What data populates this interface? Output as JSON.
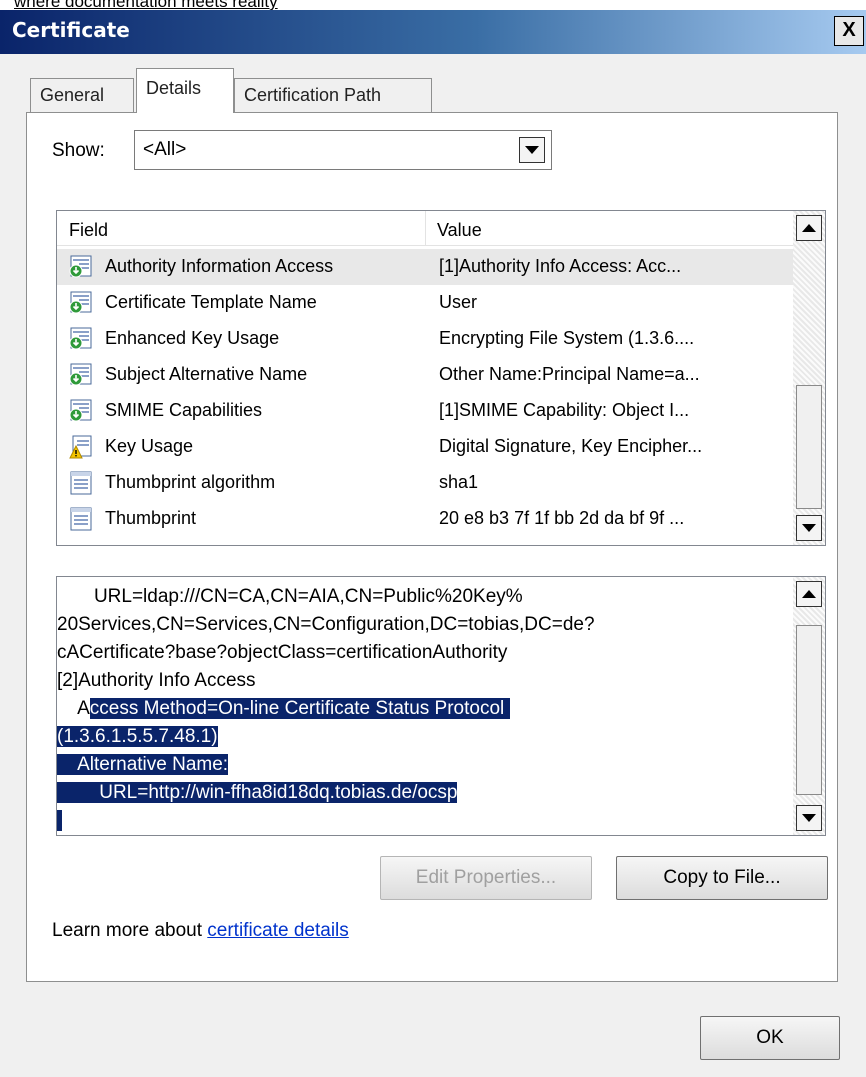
{
  "background_text": "where documentation meets reality",
  "window": {
    "title": "Certificate",
    "close_label": "X"
  },
  "tabs": [
    {
      "label": "General"
    },
    {
      "label": "Details"
    },
    {
      "label": "Certification Path"
    }
  ],
  "show": {
    "label": "Show:",
    "selected": "<All>"
  },
  "list": {
    "headers": {
      "field": "Field",
      "value": "Value"
    },
    "rows": [
      {
        "field": "Authority Information Access",
        "value": "[1]Authority Info Access: Acc...",
        "icon": "cert-extension-icon"
      },
      {
        "field": "Certificate Template Name",
        "value": "User",
        "icon": "cert-extension-icon"
      },
      {
        "field": "Enhanced Key Usage",
        "value": "Encrypting File System (1.3.6....",
        "icon": "cert-extension-icon"
      },
      {
        "field": "Subject Alternative Name",
        "value": "Other Name:Principal Name=a...",
        "icon": "cert-extension-icon"
      },
      {
        "field": "SMIME Capabilities",
        "value": "[1]SMIME Capability: Object I...",
        "icon": "cert-extension-icon"
      },
      {
        "field": "Key Usage",
        "value": "Digital Signature, Key Encipher...",
        "icon": "critical-extension-warning-icon"
      },
      {
        "field": "Thumbprint algorithm",
        "value": "sha1",
        "icon": "property-icon"
      },
      {
        "field": "Thumbprint",
        "value": "20 e8 b3 7f 1f bb 2d da bf 9f ...",
        "icon": "property-icon"
      }
    ]
  },
  "detail": {
    "lines": [
      {
        "pre": "       URL=ldap:///CN=CA,CN=AIA,CN=Public%20Key%",
        "hl": ""
      },
      {
        "pre": "20Services,CN=Services,CN=Configuration,DC=tobias,DC=de?",
        "hl": ""
      },
      {
        "pre": "cACertificate?base?objectClass=certificationAuthority",
        "hl": ""
      },
      {
        "pre": "[2]Authority Info Access",
        "hl": ""
      },
      {
        "pre": "    A",
        "hl": "ccess Method=On-line Certificate Status Protocol "
      },
      {
        "pre": "",
        "hl": "(1.3.6.1.5.5.7.48.1)"
      },
      {
        "pre": "",
        "hl": "    Alternative Name:"
      },
      {
        "pre": "",
        "hl": "        URL=http://win-ffha8id18dq.tobias.de/ocsp"
      },
      {
        "pre": "",
        "hl": " "
      }
    ]
  },
  "buttons": {
    "edit": "Edit Properties...",
    "copy": "Copy to File...",
    "ok": "OK"
  },
  "learn": {
    "text": "Learn more about ",
    "link": "certificate details"
  }
}
